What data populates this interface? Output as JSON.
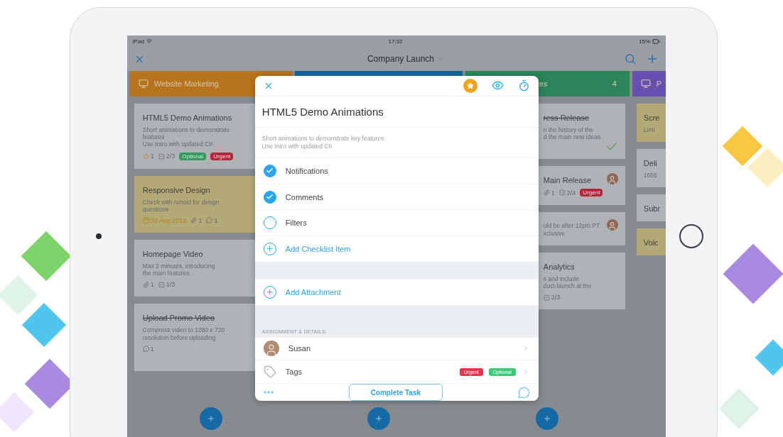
{
  "status_bar": {
    "carrier": "iPad",
    "time": "17:32",
    "battery": "15%"
  },
  "nav": {
    "title": "Company Launch"
  },
  "columns": [
    {
      "title": "Website Marketing",
      "color": "#b8741c",
      "add_button": true,
      "cards": [
        {
          "title": "HTML5 Demo Animations",
          "lines": [
            "Short animations to demonstrate",
            "features",
            "Use Intro with updated CII"
          ],
          "meta": [
            {
              "kind": "star",
              "text": "1"
            },
            {
              "kind": "checklist",
              "text": "2/3"
            }
          ],
          "tags": [
            {
              "label": "Optional",
              "color": "#2e9e5e"
            },
            {
              "label": "Urgent",
              "color": "#b8243a"
            }
          ],
          "highlighted": false,
          "done": false
        },
        {
          "title": "Responsive Design",
          "lines": [
            "Check with Arnold for design",
            "questions"
          ],
          "meta": [
            {
              "kind": "date",
              "text": "20 Aug 2015"
            },
            {
              "kind": "attachment",
              "text": "1"
            },
            {
              "kind": "comment",
              "text": "1"
            }
          ],
          "highlighted": true,
          "done": false
        },
        {
          "title": "Homepage Video",
          "lines": [
            "Max 2 minutes, introducing",
            "the main features"
          ],
          "meta": [
            {
              "kind": "attachment",
              "text": "1"
            },
            {
              "kind": "checklist",
              "text": "1/3"
            }
          ],
          "highlighted": false,
          "done": false
        },
        {
          "title": "Upload Promo Video",
          "lines": [
            "Compress video to 1280 x 720",
            "resolution before uploading"
          ],
          "meta": [
            {
              "kind": "comment",
              "text": "1"
            }
          ],
          "highlighted": false,
          "done": true
        }
      ]
    },
    {
      "color": "#17649c",
      "add_button": true
    },
    {
      "title": "es",
      "count": "4",
      "color": "#2b845a",
      "add_button": true,
      "cards": [
        {
          "title": "ress Release",
          "lines": [
            "n the history of the",
            "d the main new ideas"
          ],
          "highlighted": false,
          "done": true,
          "assigned": false
        },
        {
          "title": "Main Release",
          "meta": [
            {
              "kind": "attachment",
              "text": "1"
            },
            {
              "kind": "checklist",
              "text": "2/4"
            }
          ],
          "tags": [
            {
              "label": "Urgent",
              "color": "#b8243a"
            }
          ],
          "highlighted": false,
          "done": false,
          "assigned": true
        },
        {
          "lines": [
            "uld be after 12pm PT",
            "xclusive"
          ],
          "highlighted": false,
          "done": false,
          "assigned": true
        },
        {
          "title": "Analytics",
          "lines": [
            "s and include",
            "duct-launch at the"
          ],
          "meta": [
            {
              "kind": "checklist",
              "text": "2/3"
            }
          ],
          "highlighted": false,
          "done": false,
          "assigned": false
        }
      ]
    },
    {
      "title": "P",
      "color": "#6650b0",
      "cards": [
        {
          "title": "Scre",
          "lines": [
            "Limi"
          ],
          "highlighted": true
        },
        {
          "title": "Deli",
          "lines": [
            "1655"
          ],
          "highlighted": false
        },
        {
          "title": "Subr",
          "highlighted": false
        },
        {
          "title": "Voic",
          "highlighted": true
        }
      ]
    }
  ],
  "task": {
    "title": "HTML5 Demo Animations",
    "starred": true,
    "description": [
      "Short animations to demonstrate key features",
      "Use Intro with updated CII"
    ],
    "checklist": [
      {
        "label": "Notifications",
        "checked": true
      },
      {
        "label": "Comments",
        "checked": true
      },
      {
        "label": "Filters",
        "checked": false
      }
    ],
    "add_checklist": "Add Checklist Item",
    "add_attachment": "Add Attachment",
    "section_label": "ASSIGNMENT & DETAILS",
    "assignee": "Susan",
    "tags_label": "Tags",
    "tags": [
      {
        "label": "Urgent",
        "color": "#e8344e"
      },
      {
        "label": "Optional",
        "color": "#3cc878"
      }
    ],
    "complete_button": "Complete Task"
  }
}
